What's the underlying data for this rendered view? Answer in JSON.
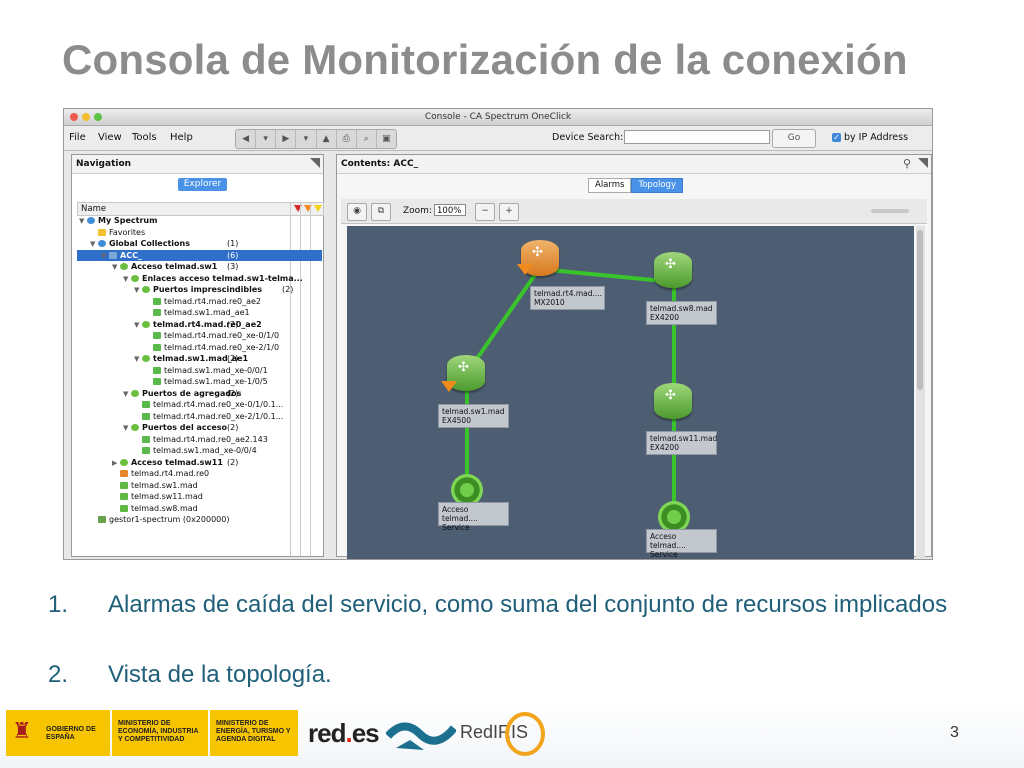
{
  "slide": {
    "title": "Consola de Monitorización de la conexión",
    "page_number": "3",
    "bullets": [
      {
        "num": "1.",
        "text": "Alarmas de caída del servicio, como suma del conjunto de recursos implicados"
      },
      {
        "num": "2.",
        "text": "Vista de la topología."
      }
    ],
    "logos": {
      "gov_espana": "GOBIERNO DE ESPAÑA",
      "ministry_1": "MINISTERIO DE ECONOMÍA, INDUSTRIA Y COMPETITIVIDAD",
      "ministry_2": "MINISTERIO DE ENERGÍA, TURISMO Y AGENDA DIGITAL",
      "redes_main": "red",
      "redes_dot": ".",
      "redes_tail": "es",
      "rediris": "RedIRIS"
    }
  },
  "app": {
    "window_title": "Console - CA Spectrum OneClick",
    "menu": [
      "File",
      "View",
      "Tools",
      "Help"
    ],
    "device_search_label": "Device Search:",
    "device_search_value": "",
    "go_label": "Go",
    "by_ip_label": "by IP Address",
    "by_ip_checked": true,
    "navigation": {
      "title": "Navigation",
      "explorer_tab": "Explorer",
      "column_name": "Name",
      "tree": [
        {
          "indent": 0,
          "exp": "▼",
          "icon": "globe",
          "label": "My Spectrum",
          "count": "",
          "bold": true
        },
        {
          "indent": 1,
          "exp": "",
          "icon": "star",
          "label": "Favorites",
          "count": "",
          "bold": false
        },
        {
          "indent": 1,
          "exp": "▼",
          "icon": "globe",
          "label": "Global Collections",
          "count": "(1)",
          "bold": true
        },
        {
          "indent": 2,
          "exp": "▼",
          "icon": "folder",
          "label": "ACC_",
          "count": "(6)",
          "bold": true,
          "selected": true
        },
        {
          "indent": 3,
          "exp": "▼",
          "icon": "service",
          "label": "Acceso telmad.sw1",
          "count": "(3)",
          "bold": true
        },
        {
          "indent": 4,
          "exp": "▼",
          "icon": "service",
          "label": "Enlaces acceso telmad.sw1-telma...",
          "count": "",
          "bold": true
        },
        {
          "indent": 5,
          "exp": "▼",
          "icon": "service",
          "label": "Puertos imprescindibles",
          "count": "(2)",
          "bold": true
        },
        {
          "indent": 6,
          "exp": "",
          "icon": "port",
          "label": "telmad.rt4.mad.re0_ae2",
          "count": "",
          "bold": false
        },
        {
          "indent": 6,
          "exp": "",
          "icon": "port",
          "label": "telmad.sw1.mad_ae1",
          "count": "",
          "bold": false
        },
        {
          "indent": 5,
          "exp": "▼",
          "icon": "service",
          "label": "telmad.rt4.mad.re0_ae2",
          "count": "(2)",
          "bold": true
        },
        {
          "indent": 6,
          "exp": "",
          "icon": "port",
          "label": "telmad.rt4.mad.re0_xe-0/1/0",
          "count": "",
          "bold": false
        },
        {
          "indent": 6,
          "exp": "",
          "icon": "port",
          "label": "telmad.rt4.mad.re0_xe-2/1/0",
          "count": "",
          "bold": false
        },
        {
          "indent": 5,
          "exp": "▼",
          "icon": "service",
          "label": "telmad.sw1.mad_ae1",
          "count": "(2)",
          "bold": true
        },
        {
          "indent": 6,
          "exp": "",
          "icon": "port",
          "label": "telmad.sw1.mad_xe-0/0/1",
          "count": "",
          "bold": false
        },
        {
          "indent": 6,
          "exp": "",
          "icon": "port",
          "label": "telmad.sw1.mad_xe-1/0/5",
          "count": "",
          "bold": false
        },
        {
          "indent": 4,
          "exp": "▼",
          "icon": "service",
          "label": "Puertos de agregados",
          "count": "(2)",
          "bold": true
        },
        {
          "indent": 5,
          "exp": "",
          "icon": "port",
          "label": "telmad.rt4.mad.re0_xe-0/1/0.1...",
          "count": "",
          "bold": false
        },
        {
          "indent": 5,
          "exp": "",
          "icon": "port",
          "label": "telmad.rt4.mad.re0_xe-2/1/0.1...",
          "count": "",
          "bold": false
        },
        {
          "indent": 4,
          "exp": "▼",
          "icon": "service",
          "label": "Puertos del acceso",
          "count": "(2)",
          "bold": true
        },
        {
          "indent": 5,
          "exp": "",
          "icon": "port",
          "label": "telmad.rt4.mad.re0_ae2.143",
          "count": "",
          "bold": false
        },
        {
          "indent": 5,
          "exp": "",
          "icon": "port",
          "label": "telmad.sw1.mad_xe-0/0/4",
          "count": "",
          "bold": false
        },
        {
          "indent": 3,
          "exp": "▶",
          "icon": "service",
          "label": "Acceso telmad.sw11",
          "count": "(2)",
          "bold": true
        },
        {
          "indent": 3,
          "exp": "",
          "icon": "router-orange",
          "label": "telmad.rt4.mad.re0",
          "count": "",
          "bold": false
        },
        {
          "indent": 3,
          "exp": "",
          "icon": "router-green",
          "label": "telmad.sw1.mad",
          "count": "",
          "bold": false
        },
        {
          "indent": 3,
          "exp": "",
          "icon": "router-green",
          "label": "telmad.sw11.mad",
          "count": "",
          "bold": false
        },
        {
          "indent": 3,
          "exp": "",
          "icon": "router-green",
          "label": "telmad.sw8.mad",
          "count": "",
          "bold": false
        },
        {
          "indent": 1,
          "exp": "",
          "icon": "server",
          "label": "gestor1-spectrum (0x200000)",
          "count": "",
          "bold": false
        }
      ]
    },
    "contents": {
      "title": "Contents: ACC_",
      "tabs": [
        "Alarms",
        "Topology"
      ],
      "active_tab": "Topology",
      "zoom_label": "Zoom:",
      "zoom_value": "100%",
      "topology_nodes": [
        {
          "id": "rt4",
          "kind": "router-orange",
          "label1": "telmad.rt4.mad....",
          "label2": "MX2010",
          "alarm": true
        },
        {
          "id": "sw8",
          "kind": "router-green",
          "label1": "telmad.sw8.mad",
          "label2": "EX4200",
          "alarm": false
        },
        {
          "id": "sw1",
          "kind": "router-green",
          "label1": "telmad.sw1.mad",
          "label2": "EX4500",
          "alarm": true
        },
        {
          "id": "sw11",
          "kind": "router-green",
          "label1": "telmad.sw11.mad",
          "label2": "EX4200",
          "alarm": false
        },
        {
          "id": "svc1",
          "kind": "service",
          "label1": "Acceso telmad....",
          "label2": "Service",
          "alarm": false
        },
        {
          "id": "svc2",
          "kind": "service",
          "label1": "Acceso telmad....",
          "label2": "Service",
          "alarm": false
        }
      ]
    }
  }
}
